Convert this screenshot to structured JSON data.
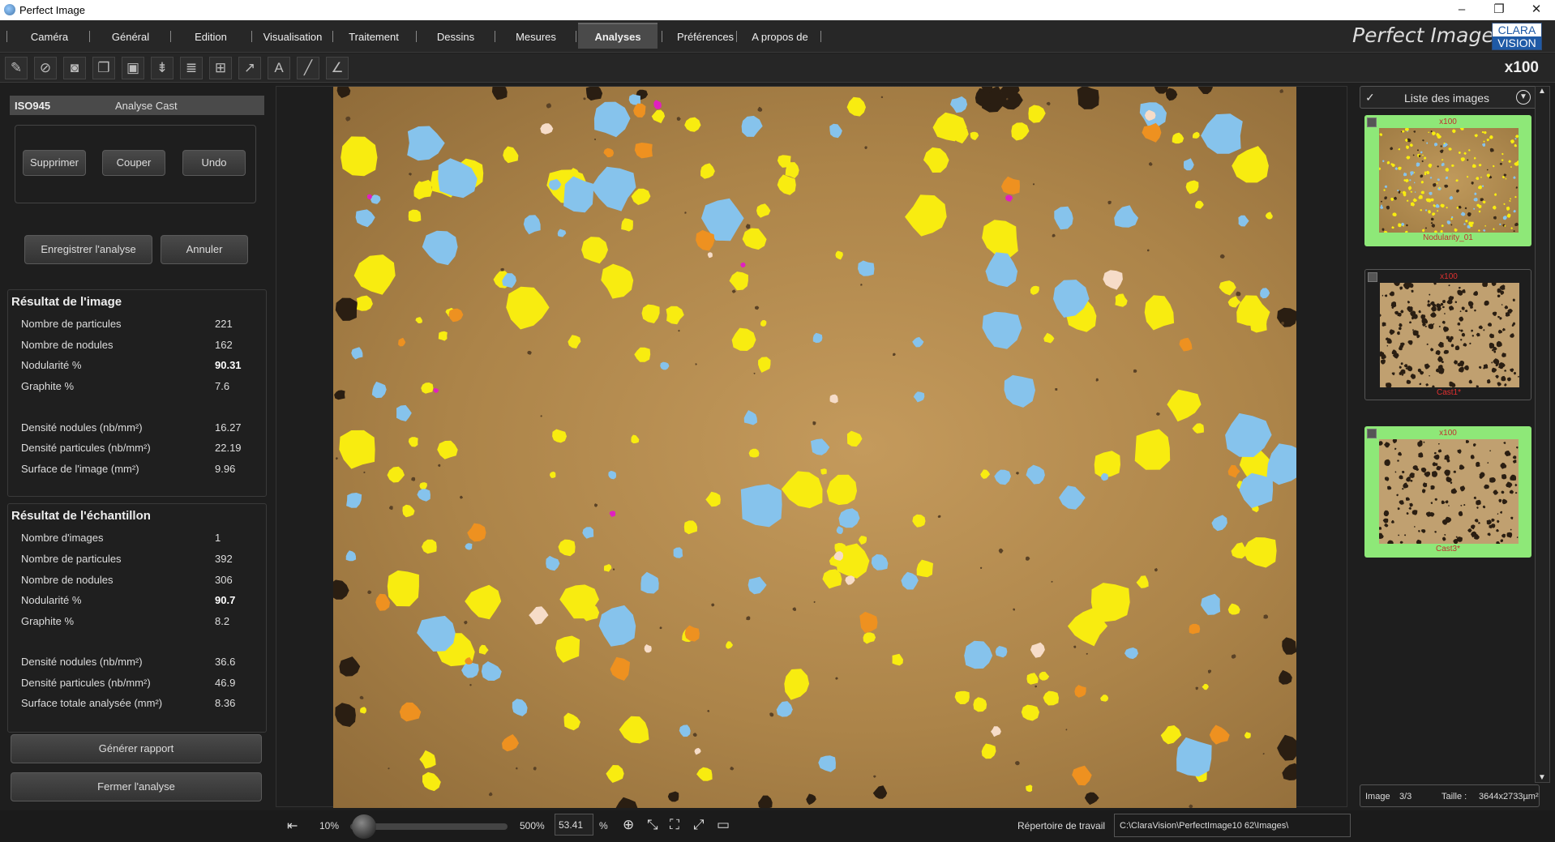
{
  "window": {
    "title": "Perfect Image",
    "minimize": "–",
    "restore": "❐",
    "close": "✕"
  },
  "menu": {
    "items": [
      "Caméra",
      "Général",
      "Edition",
      "Visualisation",
      "Traitement",
      "Dessins",
      "Mesures",
      "Analyses",
      "Préférences",
      "A propos de"
    ],
    "active": "Analyses"
  },
  "brand": {
    "name": "Perfect Image",
    "logo_top": "CLARA",
    "logo_bottom": "VISION"
  },
  "toolbar": {
    "icons": [
      "edit-icon",
      "no-camera-icon",
      "camera-icon",
      "images-icon",
      "save-icon",
      "layers-icon",
      "stack-icon",
      "grid-icon",
      "arrow-icon",
      "text-icon",
      "line-icon",
      "angle-icon"
    ],
    "zoom": "x100"
  },
  "analysis": {
    "id": "ISO945",
    "name": "Analyse Cast",
    "buttons": {
      "delete": "Supprimer",
      "cut": "Couper",
      "undo": "Undo",
      "save": "Enregistrer l'analyse",
      "cancel": "Annuler"
    },
    "image_result": {
      "title": "Résultat de l'image",
      "rows": [
        {
          "label": "Nombre de particules",
          "value": "221"
        },
        {
          "label": "Nombre de nodules",
          "value": "162"
        },
        {
          "label": "Nodularité %",
          "value": "90.31"
        },
        {
          "label": "Graphite %",
          "value": "7.6"
        },
        {
          "label": "Densité nodules (nb/mm²)",
          "value": "16.27"
        },
        {
          "label": "Densité particules (nb/mm²)",
          "value": "22.19"
        },
        {
          "label": "Surface de l'image (mm²)",
          "value": "9.96"
        }
      ]
    },
    "sample_result": {
      "title": "Résultat de l'échantillon",
      "rows": [
        {
          "label": "Nombre d'images",
          "value": "1"
        },
        {
          "label": "Nombre de particules",
          "value": "392"
        },
        {
          "label": "Nombre de nodules",
          "value": "306"
        },
        {
          "label": "Nodularité %",
          "value": "90.7"
        },
        {
          "label": "Graphite %",
          "value": "8.2"
        },
        {
          "label": "Densité nodules (nb/mm²)",
          "value": "36.6"
        },
        {
          "label": "Densité particules (nb/mm²)",
          "value": "46.9"
        },
        {
          "label": "Surface totale analysée (mm²)",
          "value": "8.36"
        }
      ]
    },
    "report_button": "Générer rapport",
    "close_button": "Fermer l'analyse"
  },
  "image_list": {
    "title": "Liste des images",
    "thumbs": [
      {
        "mag": "x100",
        "name": "Nodularity_01"
      },
      {
        "mag": "x100",
        "name": "Cast1*"
      },
      {
        "mag": "x100",
        "name": "Cast3*"
      }
    ],
    "image_label": "Image",
    "image_index": "3/3",
    "size_label": "Taille :",
    "size_value": "3644x2733µm²"
  },
  "zoombar": {
    "min": "10%",
    "max": "500%",
    "value": "53.41",
    "unit": "%",
    "level": 0.09
  },
  "workdir": {
    "label": "Répertoire de travail",
    "path": "C:\\ClaraVision\\PerfectImage10 62\\Images\\"
  },
  "colors": {
    "yellow": "#f8ec10",
    "blue": "#86c3ec",
    "orange": "#ee9120",
    "cream": "#f6dcc8",
    "magenta": "#e020c0",
    "dark": "#2a1e12",
    "thumb_sel": "#8ee878"
  }
}
